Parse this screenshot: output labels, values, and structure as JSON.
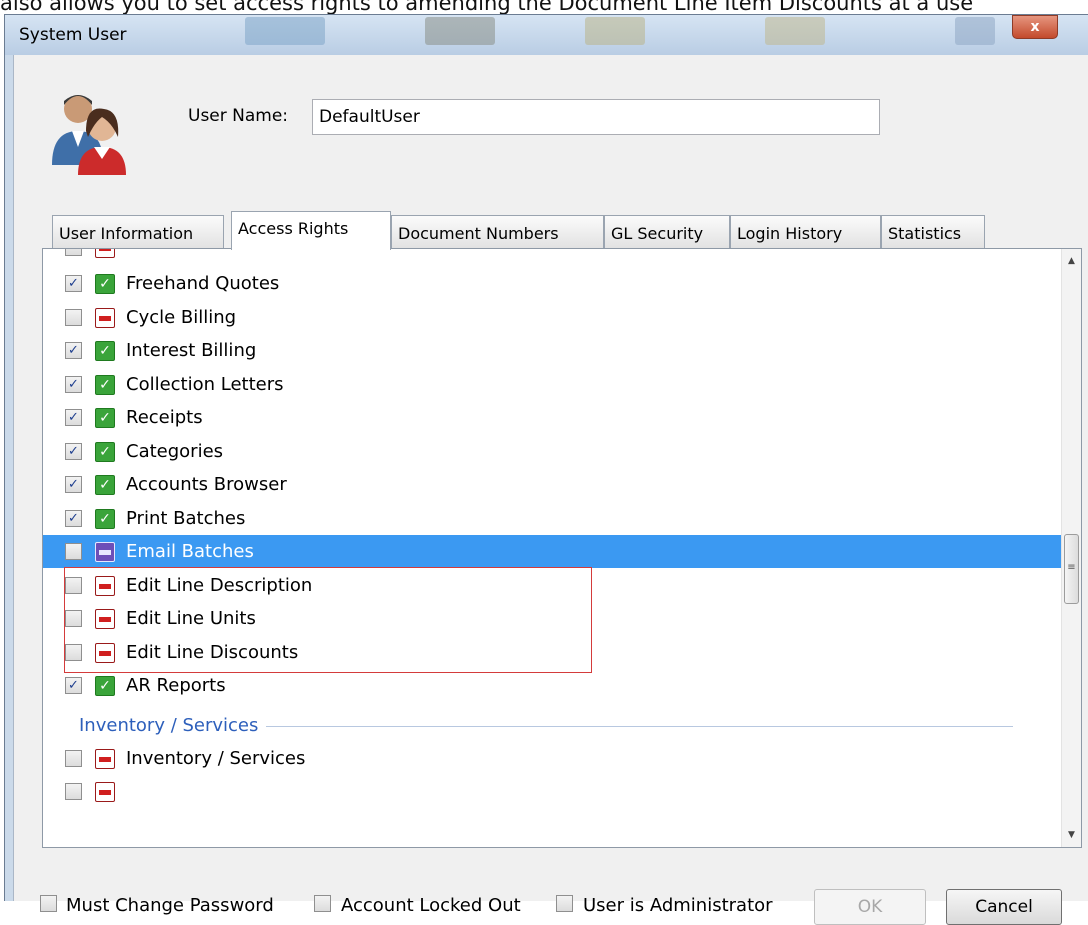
{
  "caption": "also allows you to set access rights to amending the Document Line Item Discounts at a use",
  "window": {
    "title": "System User",
    "close_label": "x"
  },
  "user": {
    "label": "User Name:",
    "value": "DefaultUser"
  },
  "tabs": [
    {
      "label": "User Information"
    },
    {
      "label": "Access Rights"
    },
    {
      "label": "Document Numbers"
    },
    {
      "label": "GL Security"
    },
    {
      "label": "Login History"
    },
    {
      "label": "Statistics"
    }
  ],
  "rights": [
    {
      "label": "Freehand Quotes",
      "checked": true,
      "status": "allow"
    },
    {
      "label": "Cycle Billing",
      "checked": false,
      "status": "deny"
    },
    {
      "label": "Interest Billing",
      "checked": true,
      "status": "allow"
    },
    {
      "label": "Collection Letters",
      "checked": true,
      "status": "allow"
    },
    {
      "label": "Receipts",
      "checked": true,
      "status": "allow"
    },
    {
      "label": "Categories",
      "checked": true,
      "status": "allow"
    },
    {
      "label": "Accounts Browser",
      "checked": true,
      "status": "allow"
    },
    {
      "label": "Print Batches",
      "checked": true,
      "status": "allow"
    },
    {
      "label": "Email Batches",
      "checked": false,
      "status": "deny",
      "selected": true
    },
    {
      "label": "Edit Line Description",
      "checked": false,
      "status": "deny"
    },
    {
      "label": "Edit Line Units",
      "checked": false,
      "status": "deny"
    },
    {
      "label": "Edit Line Discounts",
      "checked": false,
      "status": "deny"
    },
    {
      "label": "AR Reports",
      "checked": true,
      "status": "allow"
    }
  ],
  "section": {
    "label": "Inventory / Services"
  },
  "section_rights": [
    {
      "label": "Inventory / Services",
      "checked": false,
      "status": "deny"
    }
  ],
  "footer": {
    "must_change_password": "Must Change Password",
    "account_locked_out": "Account Locked Out",
    "user_is_admin": "User is Administrator",
    "ok_label": "OK",
    "cancel_label": "Cancel"
  },
  "colors": {
    "selection": "#3b99f2",
    "allow": "#3aa43a",
    "deny": "#d01f1f",
    "highlight_box": "#d43b3b"
  }
}
